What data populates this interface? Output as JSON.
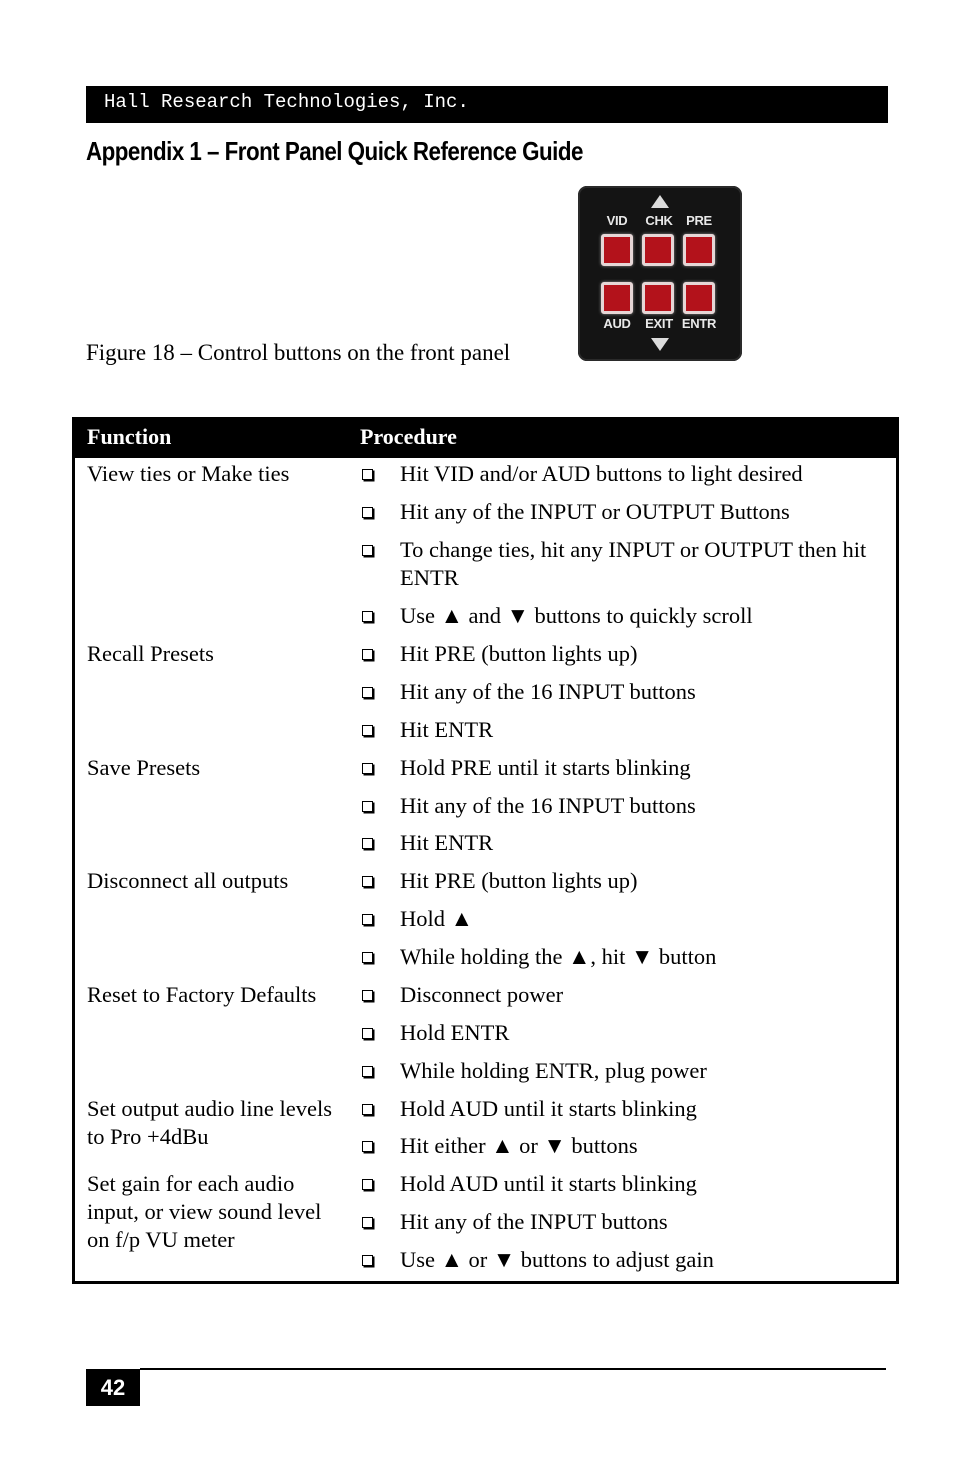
{
  "header": {
    "company": "Hall Research Technologies, Inc."
  },
  "page_title": "Appendix 1 – Front Panel Quick Reference Guide",
  "figure": {
    "caption": "Figure 18 – Control buttons on the front panel",
    "panel": {
      "up_arrow": "▲",
      "down_arrow": "▼",
      "top_labels": [
        "VID",
        "CHK",
        "PRE"
      ],
      "bottom_labels": [
        "AUD",
        "EXIT",
        "ENTR"
      ],
      "button_color": "#b3121b"
    }
  },
  "table": {
    "headers": {
      "function": "Function",
      "procedure": "Procedure"
    },
    "rows": [
      {
        "function": "View ties or Make ties",
        "steps": [
          "Hit VID and/or AUD buttons to light desired",
          "Hit any of the INPUT or OUTPUT Buttons",
          "To change ties, hit any INPUT or OUTPUT then hit ENTR",
          "Use ▲ and ▼ buttons to quickly scroll"
        ]
      },
      {
        "function": "Recall Presets",
        "steps": [
          "Hit PRE (button lights up)",
          "Hit any of the 16 INPUT buttons",
          "Hit ENTR"
        ]
      },
      {
        "function": "Save Presets",
        "steps": [
          "Hold PRE until it starts blinking",
          "Hit any of the 16 INPUT buttons",
          "Hit ENTR"
        ]
      },
      {
        "function": "Disconnect all outputs",
        "steps": [
          "Hit PRE (button lights up)",
          "Hold ▲",
          "While holding the ▲, hit ▼ button"
        ]
      },
      {
        "function": "Reset to Factory Defaults",
        "steps": [
          "Disconnect power",
          "Hold ENTR",
          "While holding ENTR, plug power"
        ]
      },
      {
        "function": "Set output audio line levels to Pro +4dBu",
        "steps": [
          "Hold AUD until it starts blinking",
          "Hit either ▲ or ▼ buttons"
        ]
      },
      {
        "function": "Set gain for each audio input, or view sound level on f/p VU meter",
        "steps": [
          "Hold AUD until it starts blinking",
          "Hit any of the INPUT buttons",
          "Use ▲ or ▼ buttons to adjust gain"
        ]
      }
    ]
  },
  "footer": {
    "page_number": "42"
  }
}
